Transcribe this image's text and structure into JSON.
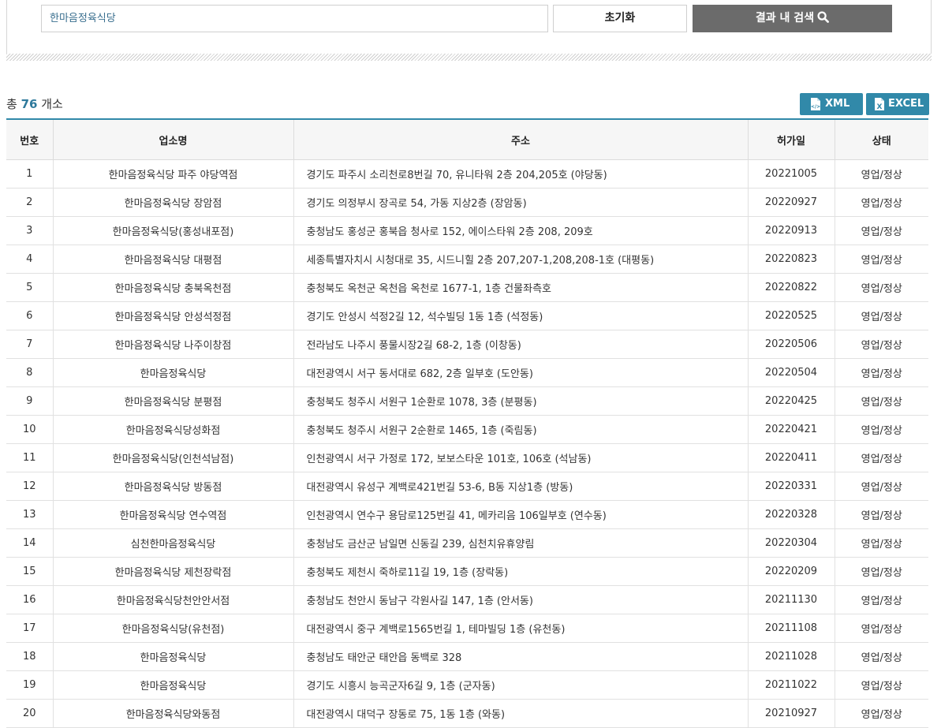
{
  "search": {
    "value": "한마음정육식당",
    "reset_label": "초기화",
    "submit_label": "결과 내 검색"
  },
  "summary": {
    "prefix": "총",
    "count": "76",
    "suffix": "개소"
  },
  "downloads": {
    "xml_label": "XML",
    "excel_label": "EXCEL"
  },
  "table": {
    "headers": [
      "번호",
      "업소명",
      "주소",
      "허가일",
      "상태"
    ],
    "rows": [
      [
        "1",
        "한마음정육식당 파주 야당역점",
        "경기도 파주시 소리천로8번길 70, 유니타워 2층 204,205호 (야당동)",
        "20221005",
        "영업/정상"
      ],
      [
        "2",
        "한마음정육식당 장암점",
        "경기도 의정부시 장곡로 54, 가동 지상2층 (장암동)",
        "20220927",
        "영업/정상"
      ],
      [
        "3",
        "한마음정육식당(홍성내포점)",
        "충청남도 홍성군 홍북읍 청사로 152, 에이스타워 2층 208, 209호",
        "20220913",
        "영업/정상"
      ],
      [
        "4",
        "한마음정육식당 대평점",
        "세종특별자치시 시청대로 35, 시드니힐 2층 207,207-1,208,208-1호 (대평동)",
        "20220823",
        "영업/정상"
      ],
      [
        "5",
        "한마음정육식당 충북옥천점",
        "충청북도 옥천군 옥천읍 옥천로 1677-1, 1층 건물좌측호",
        "20220822",
        "영업/정상"
      ],
      [
        "6",
        "한마음정육식당 안성석정점",
        "경기도 안성시 석정2길 12, 석수빌딩 1동 1층 (석정동)",
        "20220525",
        "영업/정상"
      ],
      [
        "7",
        "한마음정육식당 나주이창점",
        "전라남도 나주시 풍물시장2길 68-2, 1층 (이창동)",
        "20220506",
        "영업/정상"
      ],
      [
        "8",
        "한마음정육식당",
        "대전광역시 서구 동서대로 682, 2층 일부호 (도안동)",
        "20220504",
        "영업/정상"
      ],
      [
        "9",
        "한마음정육식당 분평점",
        "충청북도 청주시 서원구 1순환로 1078, 3층 (분평동)",
        "20220425",
        "영업/정상"
      ],
      [
        "10",
        "한마음정육식당성화점",
        "충청북도 청주시 서원구 2순환로 1465, 1층 (죽림동)",
        "20220421",
        "영업/정상"
      ],
      [
        "11",
        "한마음정육식당(인천석남점)",
        "인천광역시 서구 가정로 172, 보보스타운 101호, 106호 (석남동)",
        "20220411",
        "영업/정상"
      ],
      [
        "12",
        "한마음정육식당 방동점",
        "대전광역시 유성구 계백로421번길 53-6, B동 지상1층 (방동)",
        "20220331",
        "영업/정상"
      ],
      [
        "13",
        "한마음정육식당 연수역점",
        "인천광역시 연수구 용담로125번길 41, 메카리음 106일부호 (연수동)",
        "20220328",
        "영업/정상"
      ],
      [
        "14",
        "심천한마음정육식당",
        "충청남도 금산군 남일면 신동길 239, 심천치유휴양림",
        "20220304",
        "영업/정상"
      ],
      [
        "15",
        "한마음정육식당 제천장락점",
        "충청북도 제천시 죽하로11길 19, 1층 (장락동)",
        "20220209",
        "영업/정상"
      ],
      [
        "16",
        "한마음정육식당천안안서점",
        "충청남도 천안시 동남구 각원사길 147, 1층 (안서동)",
        "20211130",
        "영업/정상"
      ],
      [
        "17",
        "한마음정육식당(유천점)",
        "대전광역시 중구 계백로1565번길 1, 테마빌딩 1층 (유천동)",
        "20211108",
        "영업/정상"
      ],
      [
        "18",
        "한마음정육식당",
        "충청남도 태안군 태안읍 동백로 328",
        "20211028",
        "영업/정상"
      ],
      [
        "19",
        "한마음정육식당",
        "경기도 시흥시 능곡군자6길 9, 1층 (군자동)",
        "20211022",
        "영업/정상"
      ],
      [
        "20",
        "한마음정육식당와동점",
        "대전광역시 대덕구 장동로 75, 1동 1층 (와동)",
        "20210927",
        "영업/정상"
      ]
    ]
  }
}
